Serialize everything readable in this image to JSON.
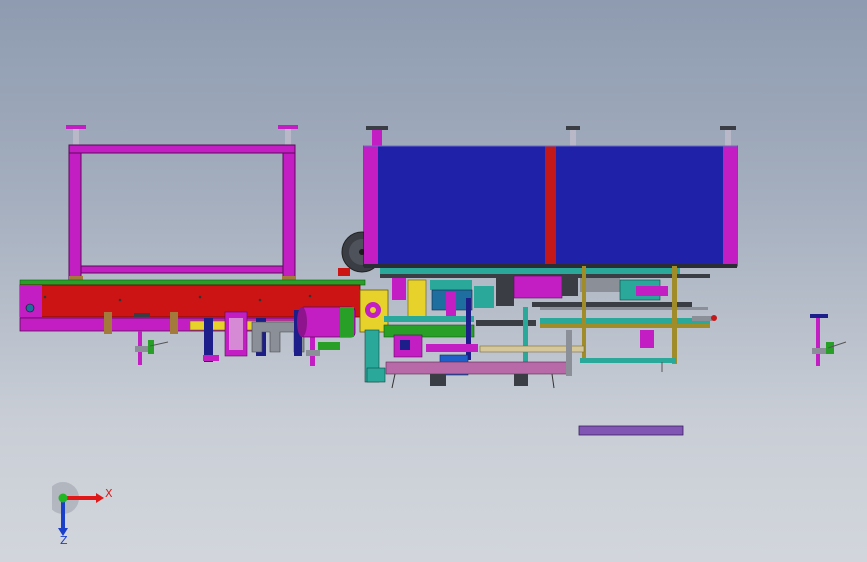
{
  "app": {
    "view": "cad-3d-viewport",
    "background_top": "#8e9bb0",
    "background_bottom": "#d2d6dc"
  },
  "colors": {
    "frame_magenta": "#c31ec3",
    "panel_blue": "#1f21a8",
    "divider_red": "#c41818",
    "rail_red": "#cc1414",
    "rail_green": "#28a028",
    "rail_yellow": "#e6d22a",
    "teal": "#2aa89a",
    "olive": "#a08c28",
    "tan": "#d6c79a",
    "gray": "#8a8f98",
    "dark_gray": "#3a3d44",
    "purple_plate": "#8055b4"
  },
  "triad": {
    "x_label": "X",
    "z_label": "Z",
    "x_color": "#e01818",
    "z_color": "#1a3fc8",
    "y_color": "#22b622"
  }
}
